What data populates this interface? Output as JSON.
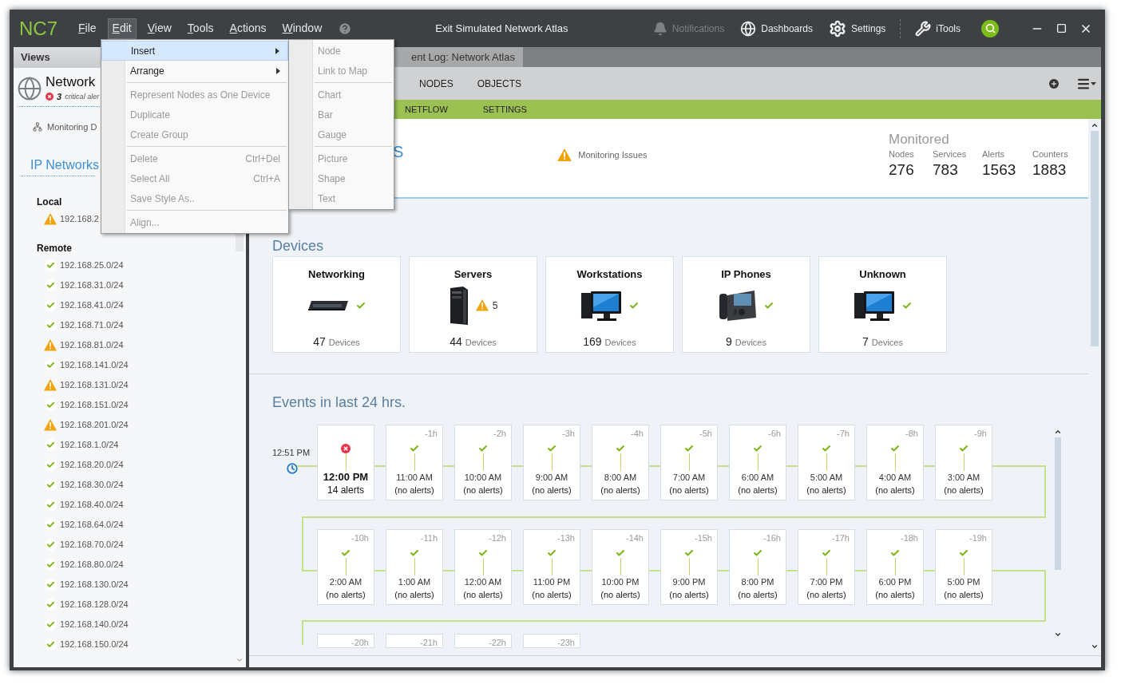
{
  "window": {
    "logo": "NC7",
    "title": "Exit Simulated Network Atlas"
  },
  "menubar": [
    {
      "label": "File",
      "selected": false
    },
    {
      "label": "Edit",
      "selected": true
    },
    {
      "label": "View",
      "selected": false
    },
    {
      "label": "Tools",
      "selected": false
    },
    {
      "label": "Actions",
      "selected": false
    },
    {
      "label": "Window",
      "selected": false
    }
  ],
  "toolbar": [
    {
      "kind": "bell",
      "label": "Notifications",
      "disabled": true
    },
    {
      "kind": "globe",
      "label": "Dashboards",
      "disabled": false
    },
    {
      "kind": "gear",
      "label": "Settings",
      "disabled": false
    },
    {
      "kind": "tools",
      "label": "iTools",
      "disabled": false
    }
  ],
  "edit_menu": [
    {
      "kind": "item",
      "label": "Insert",
      "submenu": true,
      "disabled": false,
      "selected": true
    },
    {
      "kind": "item",
      "label": "Arrange",
      "submenu": true,
      "disabled": false,
      "selected": false
    },
    {
      "kind": "separator"
    },
    {
      "kind": "item",
      "label": "Represent Nodes as One Device",
      "submenu": false,
      "disabled": true,
      "selected": false
    },
    {
      "kind": "item",
      "label": "Duplicate",
      "submenu": false,
      "disabled": true,
      "selected": false
    },
    {
      "kind": "item",
      "label": "Create Group",
      "submenu": false,
      "disabled": true,
      "selected": false
    },
    {
      "kind": "separator"
    },
    {
      "kind": "item",
      "label": "Delete",
      "shortcut": "Ctrl+Del",
      "submenu": false,
      "disabled": true,
      "selected": false
    },
    {
      "kind": "item",
      "label": "Select All",
      "shortcut": "Ctrl+A",
      "submenu": false,
      "disabled": true,
      "selected": false
    },
    {
      "kind": "item",
      "label": "Save Style As..",
      "submenu": false,
      "disabled": true,
      "selected": false
    },
    {
      "kind": "separator"
    },
    {
      "kind": "item",
      "label": "Align...",
      "submenu": false,
      "disabled": true,
      "selected": false
    }
  ],
  "insert_submenu": [
    {
      "kind": "item",
      "label": "Node",
      "disabled": true
    },
    {
      "kind": "item",
      "label": "Link to Map",
      "disabled": true
    },
    {
      "kind": "separator"
    },
    {
      "kind": "item",
      "label": "Chart",
      "disabled": true
    },
    {
      "kind": "item",
      "label": "Bar",
      "disabled": true
    },
    {
      "kind": "item",
      "label": "Gauge",
      "disabled": true
    },
    {
      "kind": "separator"
    },
    {
      "kind": "item",
      "label": "Picture",
      "disabled": true
    },
    {
      "kind": "item",
      "label": "Shape",
      "disabled": true
    },
    {
      "kind": "item",
      "label": "Text",
      "disabled": true
    }
  ],
  "sidebar": {
    "header": "Views",
    "network": {
      "title": "Network",
      "alert_count": "3",
      "alert_text": "critical aler"
    },
    "monitoring": "Monitoring D",
    "section_title": "IP Networks",
    "groups": [
      {
        "title": "Local",
        "items": [
          {
            "label": "192.168.2",
            "ok": false
          }
        ]
      },
      {
        "title": "Remote",
        "items": [
          {
            "label": "192.168.25.0/24",
            "ok": true
          },
          {
            "label": "192.168.31.0/24",
            "ok": true
          },
          {
            "label": "192.168.41.0/24",
            "ok": true
          },
          {
            "label": "192.168.71.0/24",
            "ok": true
          },
          {
            "label": "192.168.81.0/24",
            "ok": false
          },
          {
            "label": "192.168.141.0/24",
            "ok": true
          },
          {
            "label": "192.168.131.0/24",
            "ok": false
          },
          {
            "label": "192.168.151.0/24",
            "ok": true
          },
          {
            "label": "192.168.201.0/24",
            "ok": false
          },
          {
            "label": "192.168.1.0/24",
            "ok": true
          },
          {
            "label": "192.168.20.0/24",
            "ok": true
          },
          {
            "label": "192.168.30.0/24",
            "ok": true
          },
          {
            "label": "192.168.40.0/24",
            "ok": true
          },
          {
            "label": "192.168.64.0/24",
            "ok": true
          },
          {
            "label": "192.168.70.0/24",
            "ok": true
          },
          {
            "label": "192.168.80.0/24",
            "ok": true
          },
          {
            "label": "192.168.130.0/24",
            "ok": true
          },
          {
            "label": "192.168.128.0/24",
            "ok": true
          },
          {
            "label": "192.168.140.0/24",
            "ok": true
          },
          {
            "label": "192.168.150.0/24",
            "ok": true
          }
        ]
      }
    ]
  },
  "document_tab": {
    "label": "ent Log: Network Atlas"
  },
  "nav_tabs": [
    {
      "label": "NODES"
    },
    {
      "label": "OBJECTS"
    }
  ],
  "sub_tabs": [
    {
      "label": "NETFLOW"
    },
    {
      "label": "SETTINGS"
    }
  ],
  "summary": {
    "title_fragment": "S",
    "issues": "Monitoring Issues",
    "monitored": {
      "title": "Monitored",
      "stats": [
        {
          "label": "Nodes",
          "value": "276"
        },
        {
          "label": "Services",
          "value": "783"
        },
        {
          "label": "Alerts",
          "value": "1563"
        },
        {
          "label": "Counters",
          "value": "1883"
        }
      ]
    }
  },
  "devices": {
    "title": "Devices",
    "cards": [
      {
        "name": "Networking",
        "kind": "switch",
        "ok": true,
        "count": "47",
        "unit": "Devices"
      },
      {
        "name": "Servers",
        "kind": "server",
        "ok": false,
        "warnings": "5",
        "count": "44",
        "unit": "Devices"
      },
      {
        "name": "Workstations",
        "kind": "workstation",
        "ok": true,
        "count": "169",
        "unit": "Devices"
      },
      {
        "name": "IP Phones",
        "kind": "phone",
        "ok": true,
        "count": "9",
        "unit": "Devices"
      },
      {
        "name": "Unknown",
        "kind": "workstation",
        "ok": true,
        "count": "7",
        "unit": "Devices"
      }
    ]
  },
  "events": {
    "title": "Events in last 24 hrs.",
    "now": "12:51 PM",
    "rows": [
      [
        {
          "time": "12:00 PM",
          "alerts": "14 alerts",
          "ok": false
        },
        {
          "offset": "-1h",
          "time": "11:00 AM",
          "alerts": "(no alerts)",
          "ok": true
        },
        {
          "offset": "-2h",
          "time": "10:00 AM",
          "alerts": "(no alerts)",
          "ok": true
        },
        {
          "offset": "-3h",
          "time": "9:00 AM",
          "alerts": "(no alerts)",
          "ok": true
        },
        {
          "offset": "-4h",
          "time": "8:00 AM",
          "alerts": "(no alerts)",
          "ok": true
        },
        {
          "offset": "-5h",
          "time": "7:00 AM",
          "alerts": "(no alerts)",
          "ok": true
        },
        {
          "offset": "-6h",
          "time": "6:00 AM",
          "alerts": "(no alerts)",
          "ok": true
        },
        {
          "offset": "-7h",
          "time": "5:00 AM",
          "alerts": "(no alerts)",
          "ok": true
        },
        {
          "offset": "-8h",
          "time": "4:00 AM",
          "alerts": "(no alerts)",
          "ok": true
        },
        {
          "offset": "-9h",
          "time": "3:00 AM",
          "alerts": "(no alerts)",
          "ok": true
        }
      ],
      [
        {
          "offset": "-10h",
          "time": "2:00 AM",
          "alerts": "(no alerts)",
          "ok": true
        },
        {
          "offset": "-11h",
          "time": "1:00 AM",
          "alerts": "(no alerts)",
          "ok": true
        },
        {
          "offset": "-12h",
          "time": "12:00 AM",
          "alerts": "(no alerts)",
          "ok": true
        },
        {
          "offset": "-13h",
          "time": "11:00 PM",
          "alerts": "(no alerts)",
          "ok": true
        },
        {
          "offset": "-14h",
          "time": "10:00 PM",
          "alerts": "(no alerts)",
          "ok": true
        },
        {
          "offset": "-15h",
          "time": "9:00 PM",
          "alerts": "(no alerts)",
          "ok": true
        },
        {
          "offset": "-16h",
          "time": "8:00 PM",
          "alerts": "(no alerts)",
          "ok": true
        },
        {
          "offset": "-17h",
          "time": "7:00 PM",
          "alerts": "(no alerts)",
          "ok": true
        },
        {
          "offset": "-18h",
          "time": "6:00 PM",
          "alerts": "(no alerts)",
          "ok": true
        },
        {
          "offset": "-19h",
          "time": "5:00 PM",
          "alerts": "(no alerts)",
          "ok": true
        }
      ],
      [
        {
          "offset": "-20h"
        },
        {
          "offset": "-21h"
        },
        {
          "offset": "-22h"
        },
        {
          "offset": "-23h"
        }
      ]
    ]
  }
}
